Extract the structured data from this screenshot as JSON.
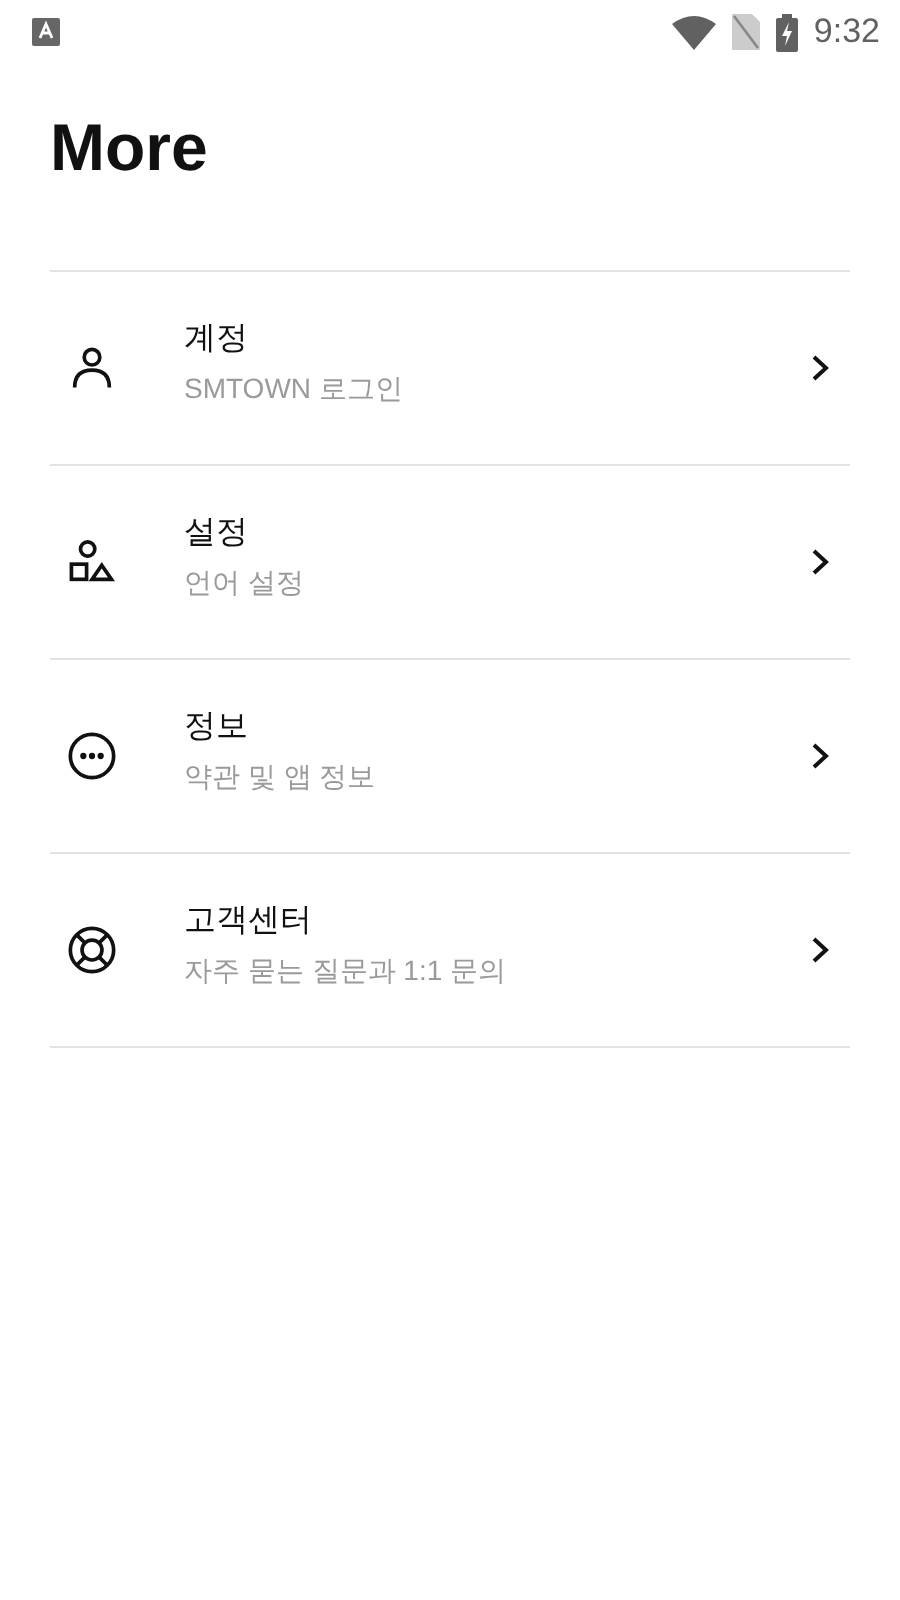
{
  "status_bar": {
    "time": "9:32"
  },
  "title": "More",
  "menu": [
    {
      "kind": "account",
      "label": "계정",
      "subtitle": "SMTOWN 로그인"
    },
    {
      "kind": "settings",
      "label": "설정",
      "subtitle": "언어 설정"
    },
    {
      "kind": "info",
      "label": "정보",
      "subtitle": "약관 및 앱 정보"
    },
    {
      "kind": "support",
      "label": "고객센터",
      "subtitle": "자주 묻는 질문과 1:1 문의"
    }
  ]
}
